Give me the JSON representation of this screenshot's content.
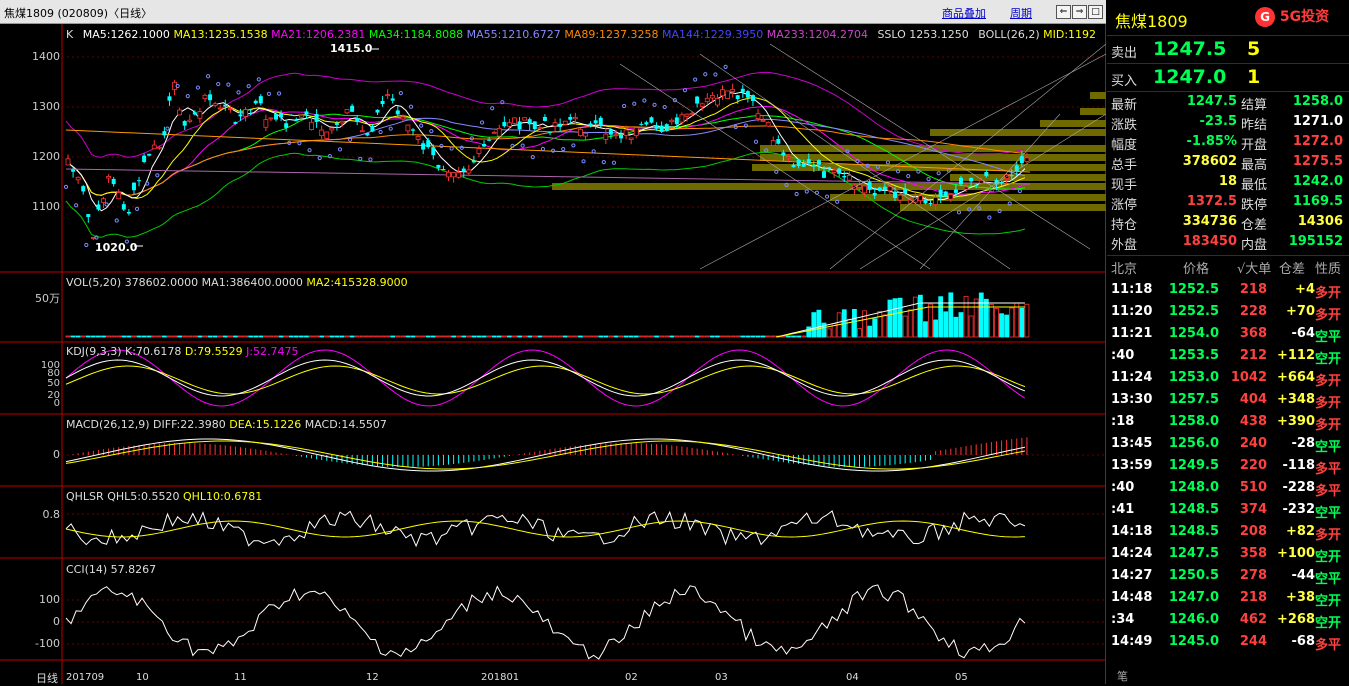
{
  "window": {
    "title": "焦煤1809 (020809)〈日线〉",
    "overlay_link": "商品叠加",
    "period_link": "周期"
  },
  "ma_line": {
    "k": "K",
    "ma5": "MA5:1262.1000",
    "ma13": "MA13:1235.1538",
    "ma21": "MA21:1206.2381",
    "ma34": "MA34:1184.8088",
    "ma55": "MA55:1210.6727",
    "ma89": "MA89:1237.3258",
    "ma144": "MA144:1229.3950",
    "ma233": "MA233:1204.2704",
    "sslo": "SSLO  1253.1250",
    "boll": "BOLL(26,2)",
    "mid": "MID:1192"
  },
  "price_axis": [
    "1400",
    "1300",
    "1200",
    "1100"
  ],
  "annotations": {
    "high": "1415.0",
    "low": "1020.0"
  },
  "vol": {
    "label": "VOL(5,20) 378602.0000",
    "ma1": "MA1:386400.0000",
    "ma2": "MA2:415328.9000",
    "axis": "50万"
  },
  "kdj": {
    "label": "KDJ(9,3,3) K:70.6178",
    "d": "D:79.5529",
    "j": "J:52.7475",
    "axis": [
      "100",
      "80",
      "50",
      "20",
      "0"
    ]
  },
  "macd": {
    "label": "MACD(26,12,9) DIFF:22.3980",
    "dea": "DEA:15.1226",
    "macd": "MACD:14.5507",
    "axis": "0"
  },
  "qhlsr": {
    "label": "QHLSR",
    "q5": "QHL5:0.5520",
    "q10": "QHL10:0.6781",
    "axis": "0.8"
  },
  "cci": {
    "label": "CCI(14) 57.8267",
    "axis": [
      "100",
      "0",
      "-100"
    ]
  },
  "x_axis": {
    "corner": "日线",
    "labels": [
      "201709",
      "10",
      "11",
      "12",
      "201801",
      "02",
      "03",
      "04",
      "05"
    ]
  },
  "colors": {
    "up": "#ff3333",
    "down": "#00ffff",
    "ma5": "#ffffff",
    "ma13": "#ffff00",
    "ma21": "#ff00ff",
    "ma34": "#00ff00",
    "ma55": "#8888ff",
    "ma89": "#ff8800",
    "ma144": "#4444ff",
    "ma233": "#cc44cc"
  },
  "quote": {
    "name": "焦煤1809",
    "logo": "5G投资",
    "sell_label": "卖出",
    "sell_price": "1247.5",
    "sell_vol": "5",
    "buy_label": "买入",
    "buy_price": "1247.0",
    "buy_vol": "1",
    "fields": [
      {
        "k1": "最新",
        "v1": "1247.5",
        "c1": "g",
        "k2": "结算",
        "v2": "1258.0",
        "c2": "g"
      },
      {
        "k1": "涨跌",
        "v1": "-23.5",
        "c1": "g",
        "k2": "昨结",
        "v2": "1271.0",
        "c2": "w"
      },
      {
        "k1": "幅度",
        "v1": "-1.85%",
        "c1": "g",
        "k2": "开盘",
        "v2": "1272.0",
        "c2": "r"
      },
      {
        "k1": "总手",
        "v1": "378602",
        "c1": "y",
        "k2": "最高",
        "v2": "1275.5",
        "c2": "r"
      },
      {
        "k1": "现手",
        "v1": "18",
        "c1": "y",
        "k2": "最低",
        "v2": "1242.0",
        "c2": "g"
      },
      {
        "k1": "涨停",
        "v1": "1372.5",
        "c1": "r",
        "k2": "跌停",
        "v2": "1169.5",
        "c2": "g"
      },
      {
        "k1": "持仓",
        "v1": "334736",
        "c1": "y",
        "k2": "仓差",
        "v2": "14306",
        "c2": "y"
      },
      {
        "k1": "外盘",
        "v1": "183450",
        "c1": "r",
        "k2": "内盘",
        "v2": "195152",
        "c2": "g"
      }
    ],
    "trade_header": [
      "北京",
      "价格",
      "√大单",
      "仓差",
      "性质"
    ],
    "trades": [
      [
        "11:18",
        "1252.5",
        "218",
        "+4",
        "多开"
      ],
      [
        "11:20",
        "1252.5",
        "228",
        "+70",
        "多开"
      ],
      [
        "11:21",
        "1254.0",
        "368",
        "-64",
        "空平"
      ],
      [
        ":40",
        "1253.5",
        "212",
        "+112",
        "空开"
      ],
      [
        "11:24",
        "1253.0",
        "1042",
        "+664",
        "多开"
      ],
      [
        "13:30",
        "1257.5",
        "404",
        "+348",
        "多开"
      ],
      [
        ":18",
        "1258.0",
        "438",
        "+390",
        "多开"
      ],
      [
        "13:45",
        "1256.0",
        "240",
        "-28",
        "空平"
      ],
      [
        "13:59",
        "1249.5",
        "220",
        "-118",
        "多平"
      ],
      [
        ":40",
        "1248.0",
        "510",
        "-228",
        "多平"
      ],
      [
        ":41",
        "1248.5",
        "374",
        "-232",
        "空平"
      ],
      [
        "14:18",
        "1248.5",
        "208",
        "+82",
        "多开"
      ],
      [
        "14:24",
        "1247.5",
        "358",
        "+100",
        "空开"
      ],
      [
        "14:27",
        "1250.5",
        "278",
        "-44",
        "空平"
      ],
      [
        "14:48",
        "1247.0",
        "218",
        "+38",
        "空开"
      ],
      [
        ":34",
        "1246.0",
        "462",
        "+268",
        "空开"
      ],
      [
        "14:49",
        "1245.0",
        "244",
        "-68",
        "多平"
      ]
    ],
    "footer": "笔"
  }
}
